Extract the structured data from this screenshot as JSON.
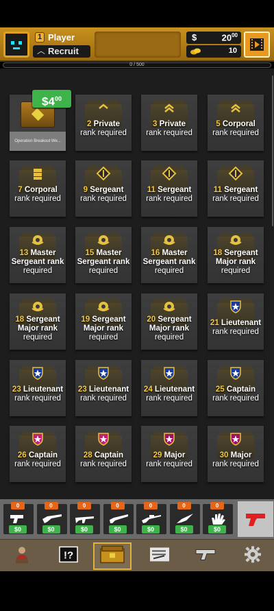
{
  "header": {
    "level": "1",
    "player_name": "Player",
    "rank_name": "Recruit",
    "money_main": "20",
    "money_cents": "00",
    "money_sign": "$",
    "coins": "10"
  },
  "xp": {
    "text": "0 / 500",
    "progress": 0
  },
  "crates": [
    {
      "price_main": "$4",
      "price_cents": "00",
      "label": "Operation Breakout We..."
    },
    {
      "num": "2",
      "rank": "Private",
      "suffix": "rank required"
    },
    {
      "num": "3",
      "rank": "Private",
      "suffix": "rank required"
    },
    {
      "num": "5",
      "rank": "Corporal",
      "suffix": "rank required"
    },
    {
      "num": "7",
      "rank": "Corporal",
      "suffix": "rank required"
    },
    {
      "num": "9",
      "rank": "Sergeant",
      "suffix": "rank required"
    },
    {
      "num": "11",
      "rank": "Sergeant",
      "suffix": "rank required"
    },
    {
      "num": "11",
      "rank": "Sergeant",
      "suffix": "rank required"
    },
    {
      "num": "13",
      "rank": "Master Sergeant rank",
      "suffix": "required"
    },
    {
      "num": "15",
      "rank": "Master Sergeant rank",
      "suffix": "required"
    },
    {
      "num": "16",
      "rank": "Master Sergeant rank",
      "suffix": "required"
    },
    {
      "num": "18",
      "rank": "Sergeant Major rank",
      "suffix": "required"
    },
    {
      "num": "18",
      "rank": "Sergeant Major rank",
      "suffix": "required"
    },
    {
      "num": "19",
      "rank": "Sergeant Major rank",
      "suffix": "required"
    },
    {
      "num": "20",
      "rank": "Sergeant Major rank",
      "suffix": "required"
    },
    {
      "num": "21",
      "rank": "Lieutenant",
      "suffix": "rank required"
    },
    {
      "num": "23",
      "rank": "Lieutenant",
      "suffix": "rank required"
    },
    {
      "num": "23",
      "rank": "Lieutenant",
      "suffix": "rank required"
    },
    {
      "num": "24",
      "rank": "Lieutenant",
      "suffix": "rank required"
    },
    {
      "num": "25",
      "rank": "Captain",
      "suffix": "rank required"
    },
    {
      "num": "26",
      "rank": "Captain",
      "suffix": "rank required"
    },
    {
      "num": "28",
      "rank": "Captain",
      "suffix": "rank required"
    },
    {
      "num": "29",
      "rank": "Major",
      "suffix": "rank required"
    },
    {
      "num": "30",
      "rank": "Major",
      "suffix": "rank required"
    }
  ],
  "weapons": [
    {
      "icon": "pistol-icon",
      "count": "0",
      "price": "$0"
    },
    {
      "icon": "rifle-icon",
      "count": "0",
      "price": "$0"
    },
    {
      "icon": "assault-rifle-icon",
      "count": "0",
      "price": "$0"
    },
    {
      "icon": "shotgun-icon",
      "count": "0",
      "price": "$0"
    },
    {
      "icon": "sniper-rifle-icon",
      "count": "0",
      "price": "$0"
    },
    {
      "icon": "knife-icon",
      "count": "0",
      "price": "$0"
    },
    {
      "icon": "glove-icon",
      "count": "0",
      "price": "$0"
    }
  ],
  "nav": [
    {
      "icon": "character-icon"
    },
    {
      "icon": "mystery-icon"
    },
    {
      "icon": "crate-icon",
      "active": true
    },
    {
      "icon": "contract-icon"
    },
    {
      "icon": "deagle-icon"
    },
    {
      "icon": "gear-icon"
    }
  ],
  "colors": {
    "gold": "#f5c842",
    "price_green": "#3db34a",
    "header": "#c8901d",
    "count_orange": "#e4661a"
  }
}
